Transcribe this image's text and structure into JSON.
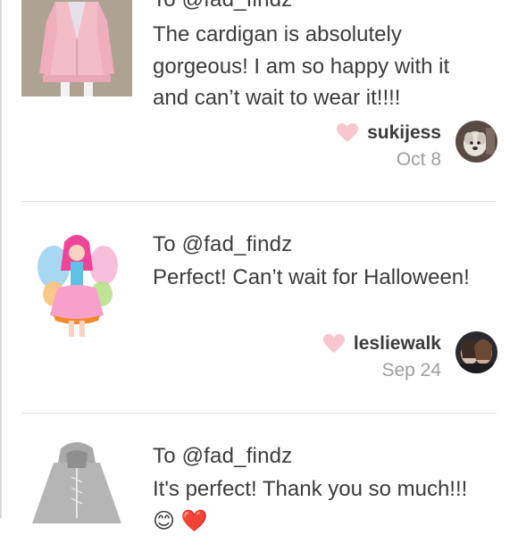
{
  "reviews": [
    {
      "to": "To @fad_findz",
      "message": "The cardigan is absolutely gorgeous! I am so happy with it and can’t wait to wear it!!!!",
      "username": "sukijess",
      "date": "Oct 8",
      "thumb_icon": "pink-cardigan-photo",
      "avatar_icon": "dog-avatar"
    },
    {
      "to": "To @fad_findz",
      "message": "Perfect! Can’t wait for Halloween!",
      "username": "lesliewalk",
      "date": "Sep 24",
      "thumb_icon": "fairy-costume-photo",
      "avatar_icon": "couple-avatar"
    },
    {
      "to": "To @fad_findz",
      "message": "It's perfect! Thank you so much!!! 😊 ❤️",
      "thumb_icon": "gray-hoodie-photo"
    }
  ],
  "colors": {
    "heart": "#f7c6cf",
    "date": "#9e9e9e",
    "divider": "#dcdcdc"
  }
}
